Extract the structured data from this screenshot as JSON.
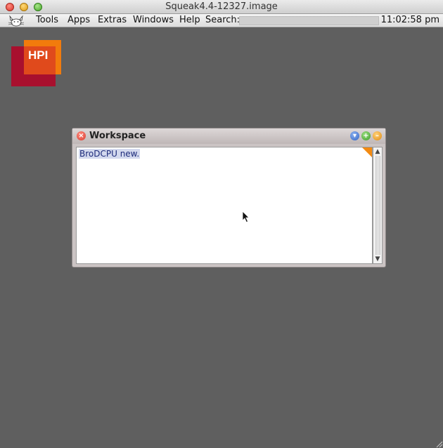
{
  "window": {
    "title": "Squeak4.4-12327.image"
  },
  "menubar": {
    "items": [
      {
        "label": "Tools"
      },
      {
        "label": "Apps"
      },
      {
        "label": "Extras"
      },
      {
        "label": "Windows"
      },
      {
        "label": "Help"
      }
    ],
    "search_label": "Search:",
    "search_value": "",
    "clock": "11:02:58 pm"
  },
  "logo": {
    "text": "HPI",
    "colors": {
      "back": "#a8102e",
      "front": "#f27b0c"
    }
  },
  "workspace": {
    "title": "Workspace",
    "content": "BroDCPU new."
  },
  "icons": {
    "app_menu": "squeak-mouse-icon",
    "close": "close-icon",
    "menu": "window-menu-icon",
    "expand": "expand-icon",
    "collapse": "collapse-icon",
    "cursor": "mouse-pointer-icon"
  }
}
